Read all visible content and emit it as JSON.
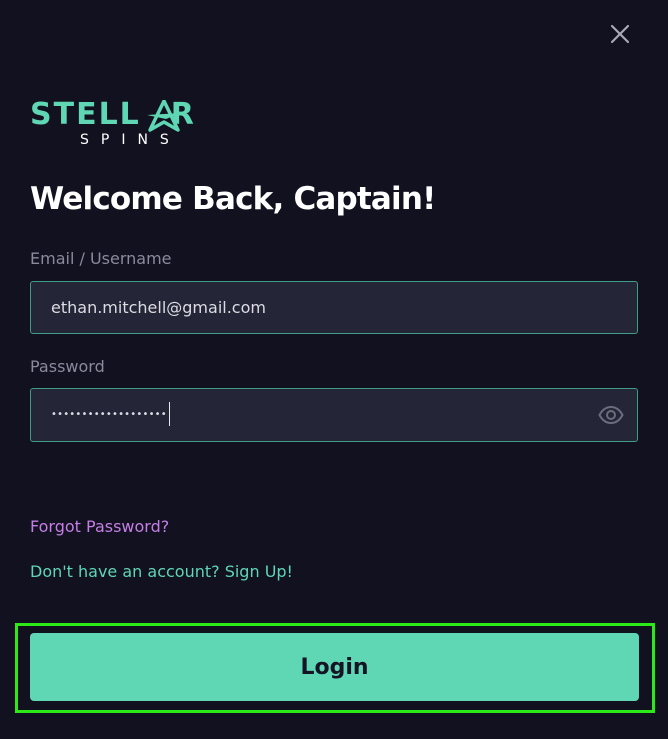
{
  "logo": {
    "line1_left": "STELL",
    "line1_right": "R",
    "line2": "SPINS"
  },
  "heading": "Welcome Back, Captain!",
  "email": {
    "label": "Email / Username",
    "value": "ethan.mitchell@gmail.com"
  },
  "password": {
    "label": "Password",
    "masked_value": "•••••••••••••••••••"
  },
  "links": {
    "forgot": "Forgot Password?",
    "signup": "Don't have an account? Sign Up!"
  },
  "login_button": "Login",
  "icons": {
    "close": "close-icon",
    "eye": "eye-icon",
    "logo_star": "star-icon"
  },
  "colors": {
    "background": "#12111f",
    "accent": "#5fd6b4",
    "link_purple": "#c47ee6",
    "input_bg": "#242536",
    "highlight": "#2bea17"
  }
}
